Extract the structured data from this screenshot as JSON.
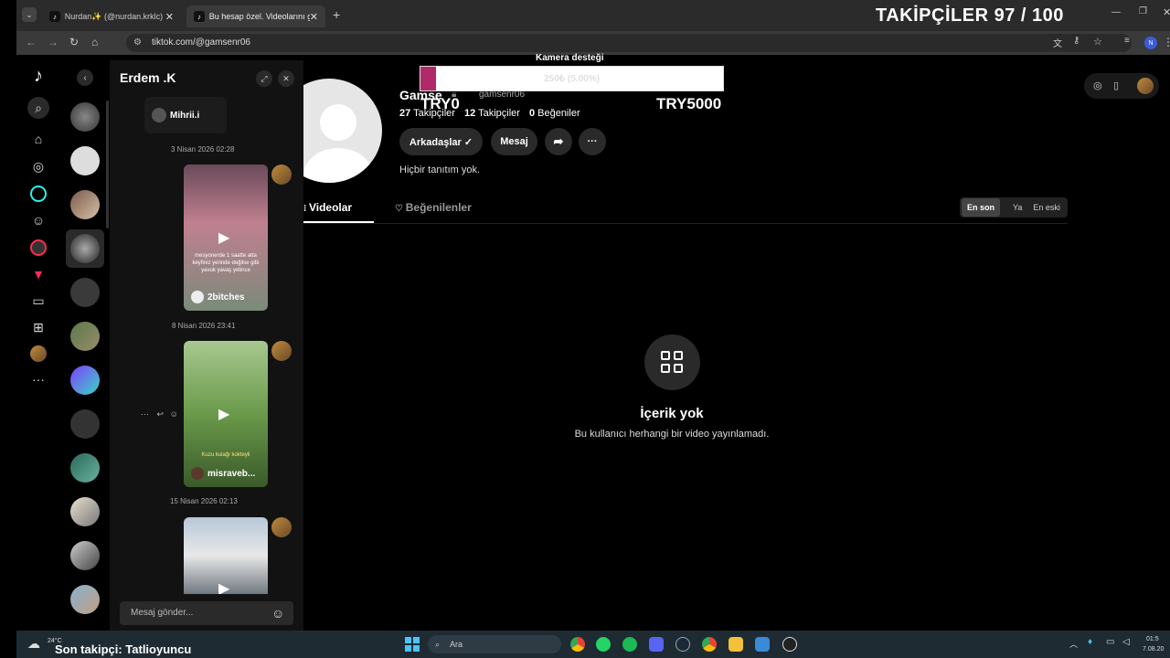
{
  "browser": {
    "tabs": [
      {
        "label": "Nurdan✨ (@nurdan.krklc) | Ti"
      },
      {
        "label": "Bu hesap özel. Videolarını görm"
      }
    ],
    "url": "tiktok.com/@gamsenr06"
  },
  "overlay": {
    "followers_goal": "TAKİPÇİLER 97 / 100",
    "camera_label": "Kamera desteği",
    "progress_text": "250₺ (5.00%)",
    "progress_fraction": 0.05,
    "min_amount": "TRY0",
    "max_amount": "TRY5000",
    "last_follower": "Son takipçi: Tatlioyuncu"
  },
  "chat": {
    "title": "Erdem .K",
    "top_user": "Mihrii.i",
    "messages": [
      {
        "time": "3 Nisan 2026 02:28",
        "caption": "2bitches",
        "overlay_text": "mesyonerde 1 saatte atta keyfiniz yerinde değilse gibi yavuk yavaş yetince"
      },
      {
        "time": "8 Nisan 2026 23:41",
        "caption": "misraveb...",
        "overlay_text": "Kuzu kulağı kokteyli"
      },
      {
        "time": "15 Nisan 2026 02:13",
        "caption": "",
        "overlay_text": ""
      }
    ],
    "input_placeholder": "Mesaj gönder..."
  },
  "profile": {
    "name": "Gamse",
    "handle": "gamsenr06",
    "followers_count": "27",
    "followers_label": "Takipçiler",
    "following_count": "12",
    "following_label": "Takipçiler",
    "likes_count": "0",
    "likes_label": "Beğeniler",
    "friends_button": "Arkadaşlar ✓",
    "message_button": "Mesaj",
    "bio": "Hiçbir tanıtım yok.",
    "tabs": [
      "Videolar",
      "Beğenilenler"
    ],
    "sort_options": [
      "En son",
      "Ya",
      "En eski"
    ],
    "empty_title": "İçerik yok",
    "empty_subtitle": "Bu kullanıcı herhangi bir video yayınlamadı."
  },
  "taskbar": {
    "weather": "24°C",
    "search_placeholder": "Ara",
    "clock": "01:5",
    "date": "7.08.20"
  }
}
